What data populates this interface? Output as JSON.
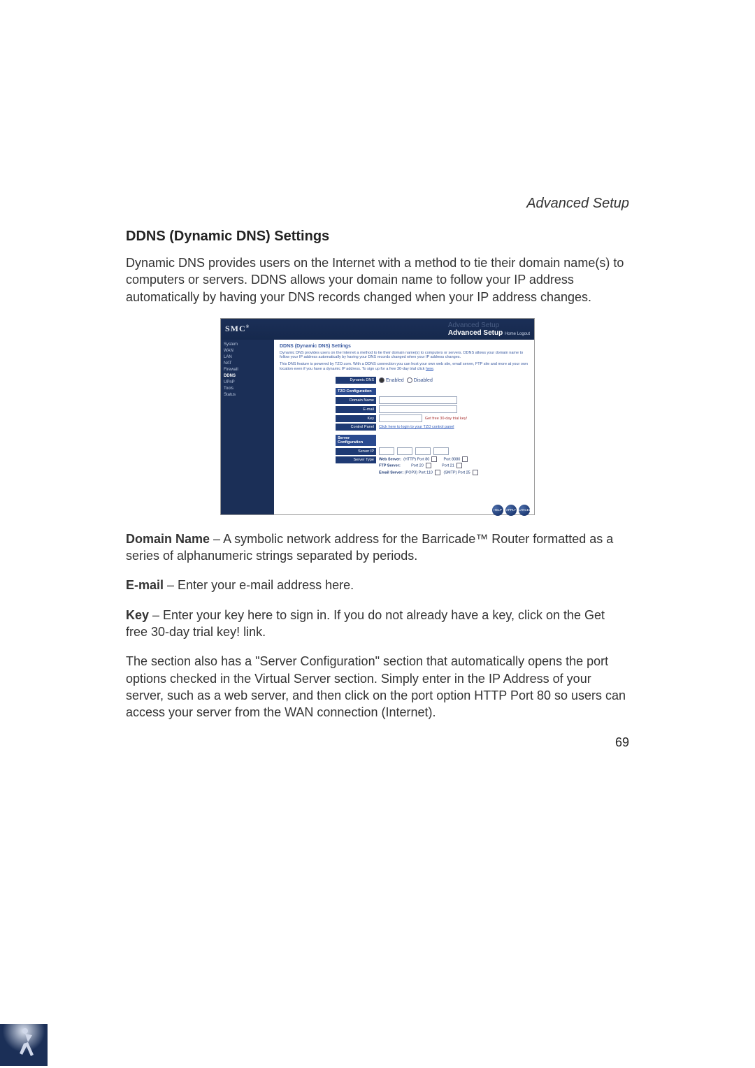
{
  "header": {
    "section": "Advanced Setup"
  },
  "title": "DDNS (Dynamic DNS) Settings",
  "intro": "Dynamic DNS provides users on the Internet with a method to tie their domain name(s) to computers or servers. DDNS allows your domain name to follow your IP address automatically by having your DNS records changed when your IP address changes.",
  "screenshot": {
    "logo": "SMC",
    "banner_dim": "Advanced Setup",
    "banner_strong": "Advanced Setup",
    "top_links": "Home   Logout",
    "sidebar": {
      "items": [
        "System",
        "WAN",
        "LAN",
        "NAT",
        "Firewall",
        "DDNS",
        "UPnP",
        "Tools",
        "Status"
      ],
      "active_index": 5
    },
    "content_title": "DDNS (Dynamic DNS) Settings",
    "desc1": "Dynamic DNS provides users on the Internet a method to tie their domain name(s) to computers or servers. DDNS allows your domain name to follow your IP address automatically by having your DNS records changed when your IP address changes.",
    "desc2_prefix": "This DNS feature is powered by TZO.com. With a DDNS connection you can host your own web site, email server, FTP site and more at your own location even if you have a dynamic IP address. To sign up for a free 30-day trial click ",
    "desc2_link": "here",
    "radio_label": "Dynamic DNS",
    "radio_enabled": "Enabled",
    "radio_disabled": "Disabled",
    "tzo_header": "TZO Configuration",
    "fields": {
      "domain": "Domain Name",
      "email": "E-mail",
      "key": "Key",
      "trial_link": "Get free 30-day trial key!",
      "control": "Control Panel",
      "control_link": "Click here to login to your TZO control panel"
    },
    "server_header": "Server Configuration",
    "server_ip": "Server IP",
    "server_type": "Server Type",
    "server_rows": {
      "web": {
        "name": "Web Server:",
        "left": "(HTTP) Port 80",
        "right": "Port 8080"
      },
      "ftp": {
        "name": "FTP Server:",
        "left": "Port 20",
        "right": "Port 21"
      },
      "email": {
        "name": "Email Server:",
        "left": "(POP3) Port 110",
        "right": "(SMTP) Port 25"
      }
    },
    "buttons": [
      "HELP",
      "APPLY",
      "CANCEL"
    ]
  },
  "defs": {
    "domain_label": "Domain Name",
    "domain_text": " – A symbolic network address for the Barricade™ Router formatted as a series of alphanumeric strings separated by periods.",
    "email_label": "E-mail",
    "email_text": " – Enter your e-mail address here.",
    "key_label": "Key",
    "key_text": " – Enter your key here to sign in. If you do not already have a key, click on the Get free 30-day trial key! link."
  },
  "server_paragraph": "The section also has a \"Server Configuration\" section that automatically opens the port options checked in the Virtual Server section. Simply enter in the IP Address of your server, such as a web server, and then click on the port option HTTP Port 80 so users can access your server from the WAN connection (Internet).",
  "page_number": "69"
}
